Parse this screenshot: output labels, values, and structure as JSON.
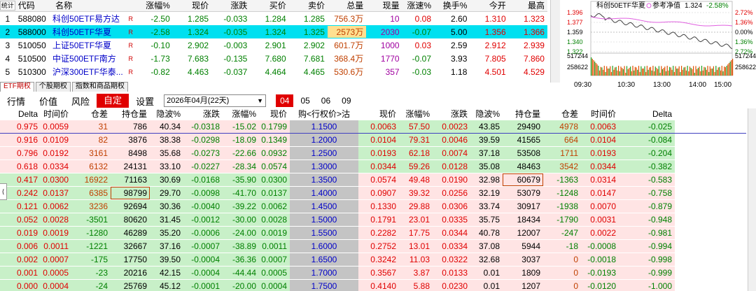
{
  "top": {
    "corner_label": "统计",
    "headers": [
      "代码",
      "名称",
      "涨幅%",
      "现价",
      "涨跌",
      "买价",
      "卖价",
      "总量",
      "现量",
      "涨速%",
      "换手%",
      "今开",
      "最高"
    ],
    "rows": [
      {
        "idx": "1",
        "code": "588080",
        "name": "科创50ETF易方达",
        "r": "R",
        "chg_pct": "-2.50",
        "price": "1.285",
        "chg": "-0.033",
        "bid": "1.284",
        "ask": "1.285",
        "vol": "756.3万",
        "cur": "10",
        "speed": "0.08",
        "turn": "2.60",
        "open": "1.310",
        "high": "1.323"
      },
      {
        "idx": "2",
        "code": "588000",
        "name": "科创50ETF华夏",
        "r": "R",
        "chg_pct": "-2.58",
        "price": "1.324",
        "chg": "-0.035",
        "bid": "1.324",
        "ask": "1.325",
        "vol": "2573万",
        "cur": "2030",
        "speed": "-0.07",
        "turn": "5.00",
        "open": "1.356",
        "high": "1.366"
      },
      {
        "idx": "3",
        "code": "510050",
        "name": "上证50ETF华夏",
        "r": "R",
        "chg_pct": "-0.10",
        "price": "2.902",
        "chg": "-0.003",
        "bid": "2.901",
        "ask": "2.902",
        "vol": "601.7万",
        "cur": "1000",
        "speed": "0.03",
        "turn": "2.59",
        "open": "2.912",
        "high": "2.939"
      },
      {
        "idx": "4",
        "code": "510500",
        "name": "中证500ETF南方",
        "r": "R",
        "chg_pct": "-1.73",
        "price": "7.683",
        "chg": "-0.135",
        "bid": "7.680",
        "ask": "7.681",
        "vol": "368.4万",
        "cur": "1770",
        "speed": "-0.07",
        "turn": "3.93",
        "open": "7.805",
        "high": "7.860"
      },
      {
        "idx": "5",
        "code": "510300",
        "name": "沪深300ETF华泰...",
        "r": "R",
        "chg_pct": "-0.82",
        "price": "4.463",
        "chg": "-0.037",
        "bid": "4.464",
        "ask": "4.465",
        "vol": "530.6万",
        "cur": "357",
        "speed": "-0.03",
        "turn": "1.18",
        "open": "4.501",
        "high": "4.529"
      }
    ]
  },
  "mini": {
    "title": "科创50ETF华夏",
    "ref_label": "参考净值",
    "ref_value": "1.324",
    "ref_pct": "-2.58%",
    "y_left": [
      "1.396",
      "1.377",
      "1.359",
      "1.340",
      "1.322"
    ],
    "y_right": [
      "2.72%",
      "1.36%",
      "0.00%",
      "1.36%",
      "2.72%"
    ],
    "vol_left": [
      "517244",
      "258622"
    ],
    "vol_right": [
      "517244",
      "258622"
    ],
    "x_labels": [
      "09:30",
      "10:30",
      "13:00",
      "14:00",
      "15:00"
    ]
  },
  "tabs": [
    "ETF期权",
    "个股期权",
    "指数和商品期权"
  ],
  "toolbar": {
    "items": [
      "行情",
      "价值",
      "风险",
      "自定",
      "设置"
    ],
    "expiry": "2026年04月(22天)",
    "months": [
      "04",
      "05",
      "06",
      "09"
    ]
  },
  "options": {
    "headers": [
      "Delta",
      "时间价",
      "仓差",
      "持仓量",
      "隐波%",
      "涨跌",
      "涨幅%",
      "现价",
      "购<行权价>沽",
      "现价",
      "涨幅%",
      "涨跌",
      "隐波%",
      "持仓量",
      "仓差",
      "时间价",
      "Delta"
    ],
    "rows": [
      {
        "c_delta": "0.975",
        "c_tv": "0.0059",
        "c_oid": "31",
        "c_oi": "786",
        "c_iv": "40.34",
        "c_chg": "-0.0318",
        "c_pct": "-15.02",
        "c_px": "0.1799",
        "k": "1.1500",
        "p_px": "0.0063",
        "p_pct": "57.50",
        "p_chg": "0.0023",
        "p_iv": "43.85",
        "p_oi": "29490",
        "p_oid": "4978",
        "p_tv": "0.0063",
        "p_delta": "-0.025"
      },
      {
        "c_delta": "0.916",
        "c_tv": "0.0109",
        "c_oid": "82",
        "c_oi": "3876",
        "c_iv": "38.38",
        "c_chg": "-0.0298",
        "c_pct": "-18.09",
        "c_px": "0.1349",
        "k": "1.2000",
        "p_px": "0.0104",
        "p_pct": "79.31",
        "p_chg": "0.0046",
        "p_iv": "39.59",
        "p_oi": "41565",
        "p_oid": "664",
        "p_tv": "0.0104",
        "p_delta": "-0.084"
      },
      {
        "c_delta": "0.796",
        "c_tv": "0.0192",
        "c_oid": "3161",
        "c_oi": "8498",
        "c_iv": "35.68",
        "c_chg": "-0.0273",
        "c_pct": "-22.66",
        "c_px": "0.0932",
        "k": "1.2500",
        "p_px": "0.0193",
        "p_pct": "62.18",
        "p_chg": "0.0074",
        "p_iv": "37.18",
        "p_oi": "53508",
        "p_oid": "1711",
        "p_tv": "0.0193",
        "p_delta": "-0.204"
      },
      {
        "c_delta": "0.618",
        "c_tv": "0.0334",
        "c_oid": "6132",
        "c_oi": "24131",
        "c_iv": "33.10",
        "c_chg": "-0.0227",
        "c_pct": "-28.34",
        "c_px": "0.0574",
        "k": "1.3000",
        "p_px": "0.0344",
        "p_pct": "59.26",
        "p_chg": "0.0128",
        "p_iv": "35.08",
        "p_oi": "48463",
        "p_oid": "3542",
        "p_tv": "0.0344",
        "p_delta": "-0.382"
      },
      {
        "c_delta": "0.417",
        "c_tv": "0.0300",
        "c_oid": "16922",
        "c_oi": "71163",
        "c_iv": "30.69",
        "c_chg": "-0.0168",
        "c_pct": "-35.90",
        "c_px": "0.0300",
        "k": "1.3500",
        "p_px": "0.0574",
        "p_pct": "49.48",
        "p_chg": "0.0190",
        "p_iv": "32.98",
        "p_oi": "60679",
        "p_oid": "-1363",
        "p_tv": "0.0314",
        "p_delta": "-0.583"
      },
      {
        "c_delta": "0.242",
        "c_tv": "0.0137",
        "c_oid": "6385",
        "c_oi": "98799",
        "c_iv": "29.70",
        "c_chg": "-0.0098",
        "c_pct": "-41.70",
        "c_px": "0.0137",
        "k": "1.4000",
        "p_px": "0.0907",
        "p_pct": "39.32",
        "p_chg": "0.0256",
        "p_iv": "32.19",
        "p_oi": "53079",
        "p_oid": "-1248",
        "p_tv": "0.0147",
        "p_delta": "-0.758"
      },
      {
        "c_delta": "0.121",
        "c_tv": "0.0062",
        "c_oid": "3236",
        "c_oi": "92694",
        "c_iv": "30.36",
        "c_chg": "-0.0040",
        "c_pct": "-39.22",
        "c_px": "0.0062",
        "k": "1.4500",
        "p_px": "0.1330",
        "p_pct": "29.88",
        "p_chg": "0.0306",
        "p_iv": "33.74",
        "p_oi": "30917",
        "p_oid": "-1938",
        "p_tv": "0.0070",
        "p_delta": "-0.879"
      },
      {
        "c_delta": "0.052",
        "c_tv": "0.0028",
        "c_oid": "-3501",
        "c_oi": "80620",
        "c_iv": "31.45",
        "c_chg": "-0.0012",
        "c_pct": "-30.00",
        "c_px": "0.0028",
        "k": "1.5000",
        "p_px": "0.1791",
        "p_pct": "23.01",
        "p_chg": "0.0335",
        "p_iv": "35.75",
        "p_oi": "18434",
        "p_oid": "-1790",
        "p_tv": "0.0031",
        "p_delta": "-0.948"
      },
      {
        "c_delta": "0.019",
        "c_tv": "0.0019",
        "c_oid": "-1280",
        "c_oi": "46289",
        "c_iv": "35.20",
        "c_chg": "-0.0006",
        "c_pct": "-24.00",
        "c_px": "0.0019",
        "k": "1.5500",
        "p_px": "0.2282",
        "p_pct": "17.75",
        "p_chg": "0.0344",
        "p_iv": "40.78",
        "p_oi": "12007",
        "p_oid": "-247",
        "p_tv": "0.0022",
        "p_delta": "-0.981"
      },
      {
        "c_delta": "0.006",
        "c_tv": "0.0011",
        "c_oid": "-1221",
        "c_oi": "32667",
        "c_iv": "37.16",
        "c_chg": "-0.0007",
        "c_pct": "-38.89",
        "c_px": "0.0011",
        "k": "1.6000",
        "p_px": "0.2752",
        "p_pct": "13.01",
        "p_chg": "0.0334",
        "p_iv": "37.08",
        "p_oi": "5944",
        "p_oid": "-18",
        "p_tv": "-0.0008",
        "p_delta": "-0.994"
      },
      {
        "c_delta": "0.002",
        "c_tv": "0.0007",
        "c_oid": "-175",
        "c_oi": "17750",
        "c_iv": "39.50",
        "c_chg": "-0.0004",
        "c_pct": "-36.36",
        "c_px": "0.0007",
        "k": "1.6500",
        "p_px": "0.3242",
        "p_pct": "11.03",
        "p_chg": "0.0322",
        "p_iv": "32.68",
        "p_oi": "3037",
        "p_oid": "0",
        "p_tv": "-0.0018",
        "p_delta": "-0.998"
      },
      {
        "c_delta": "0.001",
        "c_tv": "0.0005",
        "c_oid": "-23",
        "c_oi": "20216",
        "c_iv": "42.15",
        "c_chg": "-0.0004",
        "c_pct": "-44.44",
        "c_px": "0.0005",
        "k": "1.7000",
        "p_px": "0.3567",
        "p_pct": "3.87",
        "p_chg": "0.0133",
        "p_iv": "0.01",
        "p_oi": "1809",
        "p_oid": "0",
        "p_tv": "-0.0193",
        "p_delta": "-0.999"
      },
      {
        "c_delta": "0.000",
        "c_tv": "0.0004",
        "c_oid": "-24",
        "c_oi": "25769",
        "c_iv": "45.12",
        "c_chg": "-0.0001",
        "c_pct": "-20.00",
        "c_px": "0.0004",
        "k": "1.7500",
        "p_px": "0.4140",
        "p_pct": "5.88",
        "p_chg": "0.0230",
        "p_iv": "0.01",
        "p_oi": "1207",
        "p_oid": "0",
        "p_tv": "-0.0120",
        "p_delta": "-1.000"
      }
    ]
  }
}
